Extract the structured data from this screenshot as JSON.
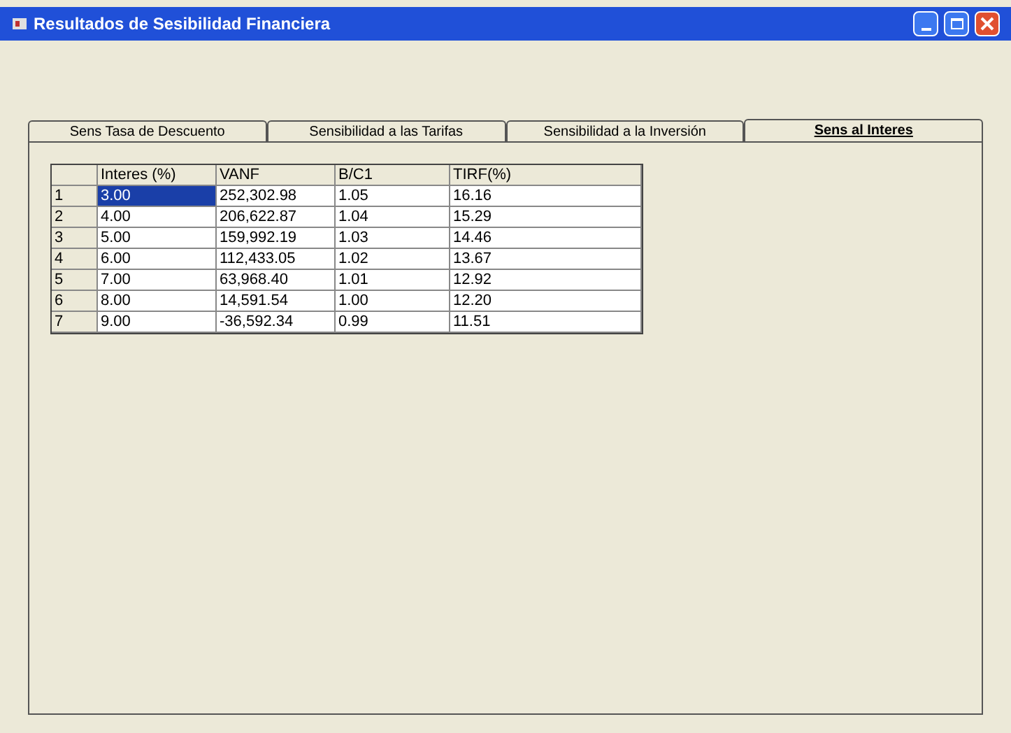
{
  "window": {
    "title": "Resultados de Sesibilidad Financiera"
  },
  "tabs": [
    {
      "label": "Sens Tasa de Descuento",
      "selected": false
    },
    {
      "label": "Sensibilidad a las Tarifas",
      "selected": false
    },
    {
      "label": "Sensibilidad a la Inversión",
      "selected": false
    },
    {
      "label": "Sens al Interes",
      "selected": true
    }
  ],
  "table": {
    "columns": [
      "Interes (%)",
      "VANF",
      "B/C1",
      "TIRF(%)"
    ],
    "rows": [
      {
        "header": "1",
        "cells": [
          "3.00",
          "252,302.98",
          "1.05",
          "16.16"
        ],
        "selected": true
      },
      {
        "header": "2",
        "cells": [
          "4.00",
          "206,622.87",
          "1.04",
          "15.29"
        ],
        "selected": false
      },
      {
        "header": "3",
        "cells": [
          "5.00",
          "159,992.19",
          "1.03",
          "14.46"
        ],
        "selected": false
      },
      {
        "header": "4",
        "cells": [
          "6.00",
          "112,433.05",
          "1.02",
          "13.67"
        ],
        "selected": false
      },
      {
        "header": "5",
        "cells": [
          "7.00",
          "63,968.40",
          "1.01",
          "12.92"
        ],
        "selected": false
      },
      {
        "header": "6",
        "cells": [
          "8.00",
          "14,591.54",
          "1.00",
          "12.20"
        ],
        "selected": false
      },
      {
        "header": "7",
        "cells": [
          "9.00",
          "-36,592.34",
          "0.99",
          "11.51"
        ],
        "selected": false
      }
    ]
  }
}
